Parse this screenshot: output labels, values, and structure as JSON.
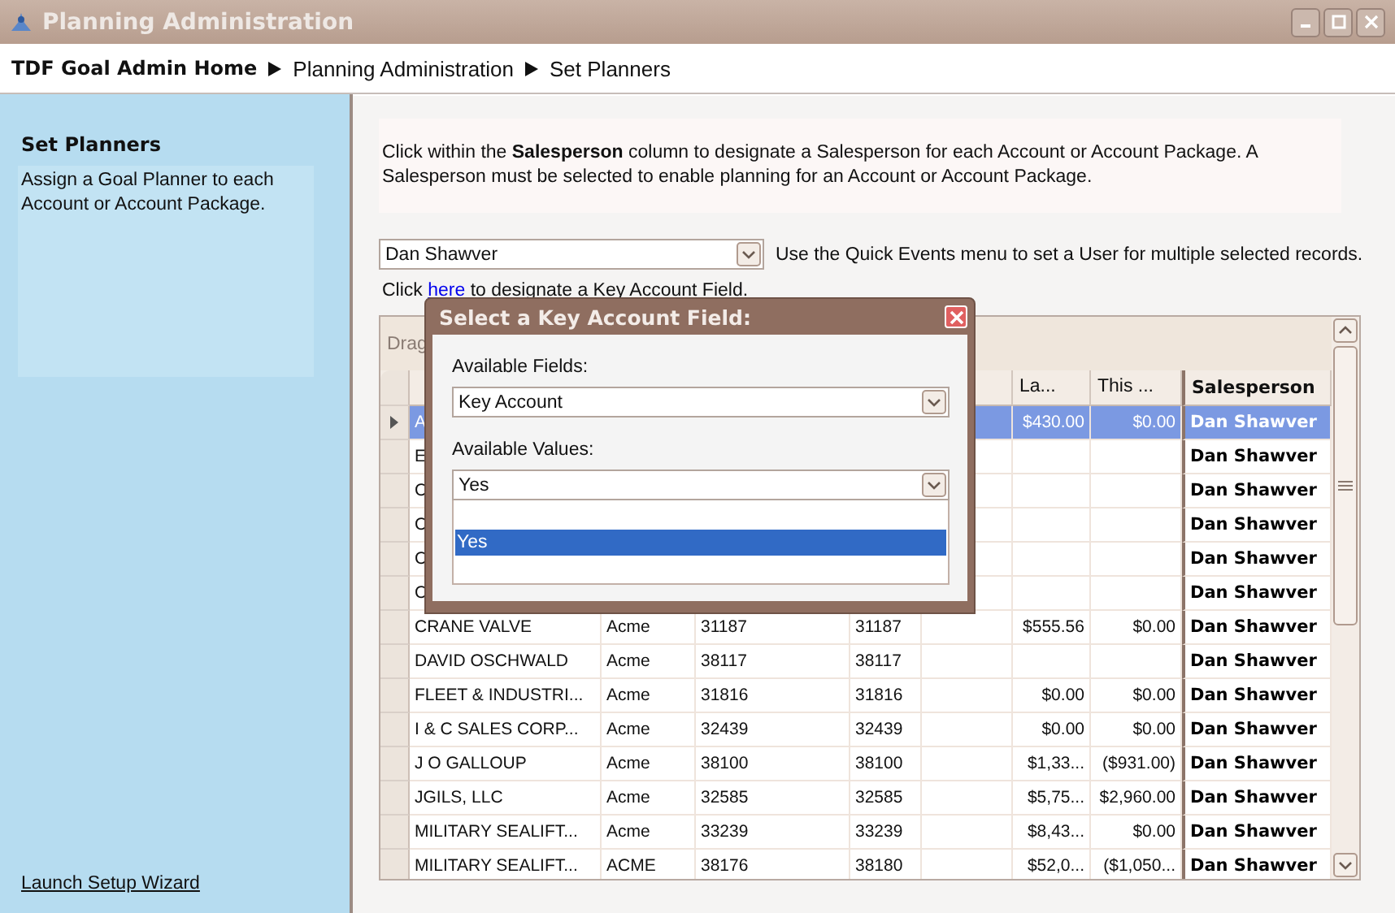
{
  "window": {
    "title": "Planning Administration"
  },
  "breadcrumb": {
    "home": "TDF Goal Admin Home",
    "items": [
      "Planning Administration",
      "Set Planners"
    ]
  },
  "sidebar": {
    "title": "Set Planners",
    "description": "Assign a Goal Planner to each Account or Account Package.",
    "link": "Launch Setup Wizard"
  },
  "intro": "Click within the **Salesperson** column to designate a Salesperson for each Account or Account Package.  A Salesperson must be selected to enable planning for an Account or Account Package.",
  "salesperson_select": {
    "value": "Dan Shawver"
  },
  "quick_events_hint": "Use the Quick Events menu to set a User for multiple selected records.",
  "key_field_hint": {
    "before": "Click",
    "link": "here",
    "after": "to designate a Key Account Field."
  },
  "grid": {
    "group_area": "Drag",
    "columns": [
      "",
      "",
      "",
      "",
      "",
      "La...",
      "This ...",
      "Salesperson"
    ],
    "rows": [
      {
        "selected": true,
        "name": "A",
        "last": "$430.00",
        "this": "$0.00",
        "salesperson": "Dan Shawver"
      },
      {
        "selected": false,
        "name": "E",
        "salesperson": "Dan Shawver"
      },
      {
        "selected": false,
        "name": "C",
        "salesperson": "Dan Shawver"
      },
      {
        "selected": false,
        "name": "C",
        "salesperson": "Dan Shawver"
      },
      {
        "selected": false,
        "name": "C",
        "salesperson": "Dan Shawver"
      },
      {
        "selected": false,
        "name": "C",
        "salesperson": "Dan Shawver"
      },
      {
        "selected": false,
        "name": "CRANE VALVE",
        "column_2": "Acme",
        "column_3": "31187",
        "column_4": "31187",
        "last": "$555.56",
        "this": "$0.00",
        "salesperson": "Dan Shawver"
      },
      {
        "selected": false,
        "name": "DAVID OSCHWALD",
        "column_2": "Acme",
        "column_3": "38117",
        "column_4": "38117",
        "salesperson": "Dan Shawver"
      },
      {
        "selected": false,
        "name": "FLEET & INDUSTRI...",
        "column_2": "Acme",
        "column_3": "31816",
        "column_4": "31816",
        "last": "$0.00",
        "this": "$0.00",
        "salesperson": "Dan Shawver"
      },
      {
        "selected": false,
        "name": "I & C SALES CORP...",
        "column_2": "Acme",
        "column_3": "32439",
        "column_4": "32439",
        "last": "$0.00",
        "this": "$0.00",
        "salesperson": "Dan Shawver"
      },
      {
        "selected": false,
        "name": "J O GALLOUP",
        "column_2": "Acme",
        "column_3": "38100",
        "column_4": "38100",
        "last": "$1,33...",
        "this": "($931.00)",
        "salesperson": "Dan Shawver"
      },
      {
        "selected": false,
        "name": "JGILS, LLC",
        "column_2": "Acme",
        "column_3": "32585",
        "column_4": "32585",
        "last": "$5,75...",
        "this": "$2,960.00",
        "salesperson": "Dan Shawver"
      },
      {
        "selected": false,
        "name": "MILITARY SEALIFT...",
        "column_2": "Acme",
        "column_3": "33239",
        "column_4": "33239",
        "last": "$8,43...",
        "this": "$0.00",
        "salesperson": "Dan Shawver"
      },
      {
        "selected": false,
        "name": "MILITARY SEALIFT...",
        "column_2": "ACME",
        "column_3": "38176",
        "column_4": "38180",
        "last": "$52,0...",
        "this": "($1,050...",
        "salesperson": "Dan Shawver"
      }
    ]
  },
  "dialog": {
    "title": "Select a Key Account Field:",
    "fields_label": "Available Fields:",
    "field_value": "Key Account",
    "values_label": "Available Values:",
    "value": "Yes",
    "options": [
      {
        "label": "Yes",
        "selected": true
      }
    ]
  }
}
